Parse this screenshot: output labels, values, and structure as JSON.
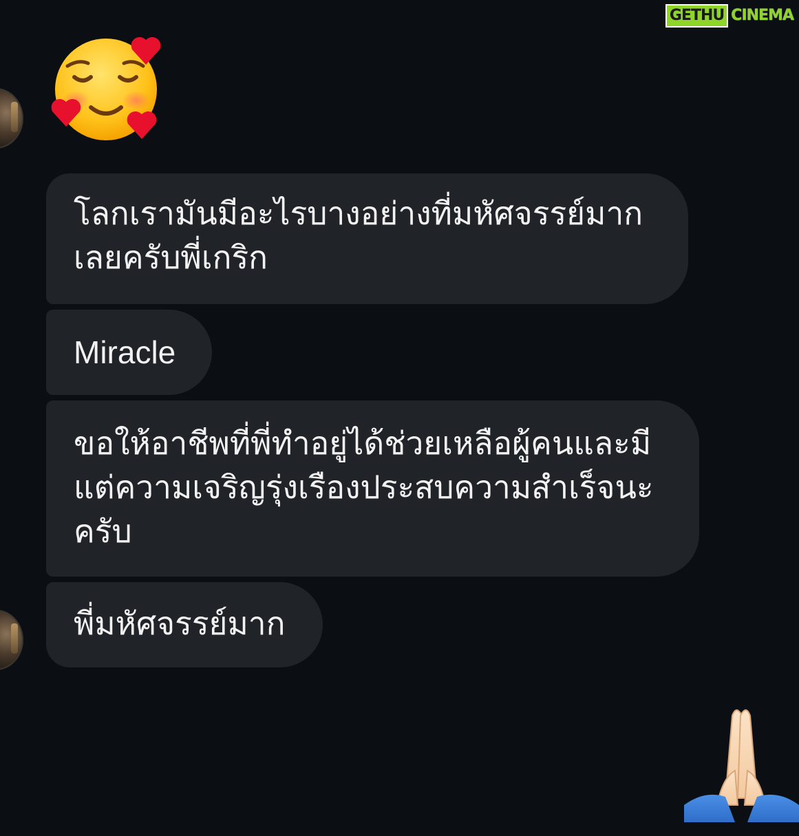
{
  "watermark": {
    "part1": "GETHU",
    "part2": "CINEMA"
  },
  "messages": [
    {
      "text": "โลกเรามันมีอะไรบางอย่างที่มหัศจรรย์มาก\nเลยครับพี่เกริก"
    },
    {
      "text": "Miracle"
    },
    {
      "text": "ขอให้อาชีพที่พี่ทำอยู่ได้ช่วยเหลือผู้คนและมี\nแต่ความเจริญรุ่งเรืองประสบความสำเร็จนะ\nครับ"
    },
    {
      "text": "พี่มหัศจรรย์มาก"
    }
  ],
  "reactions": {
    "top_emoji": "smiling-face-with-hearts",
    "bottom_emoji": "folded-hands"
  },
  "colors": {
    "background": "#0b0e12",
    "bubble": "#202328",
    "text": "#f2f2f2",
    "watermark_accent": "#8fd42a"
  }
}
